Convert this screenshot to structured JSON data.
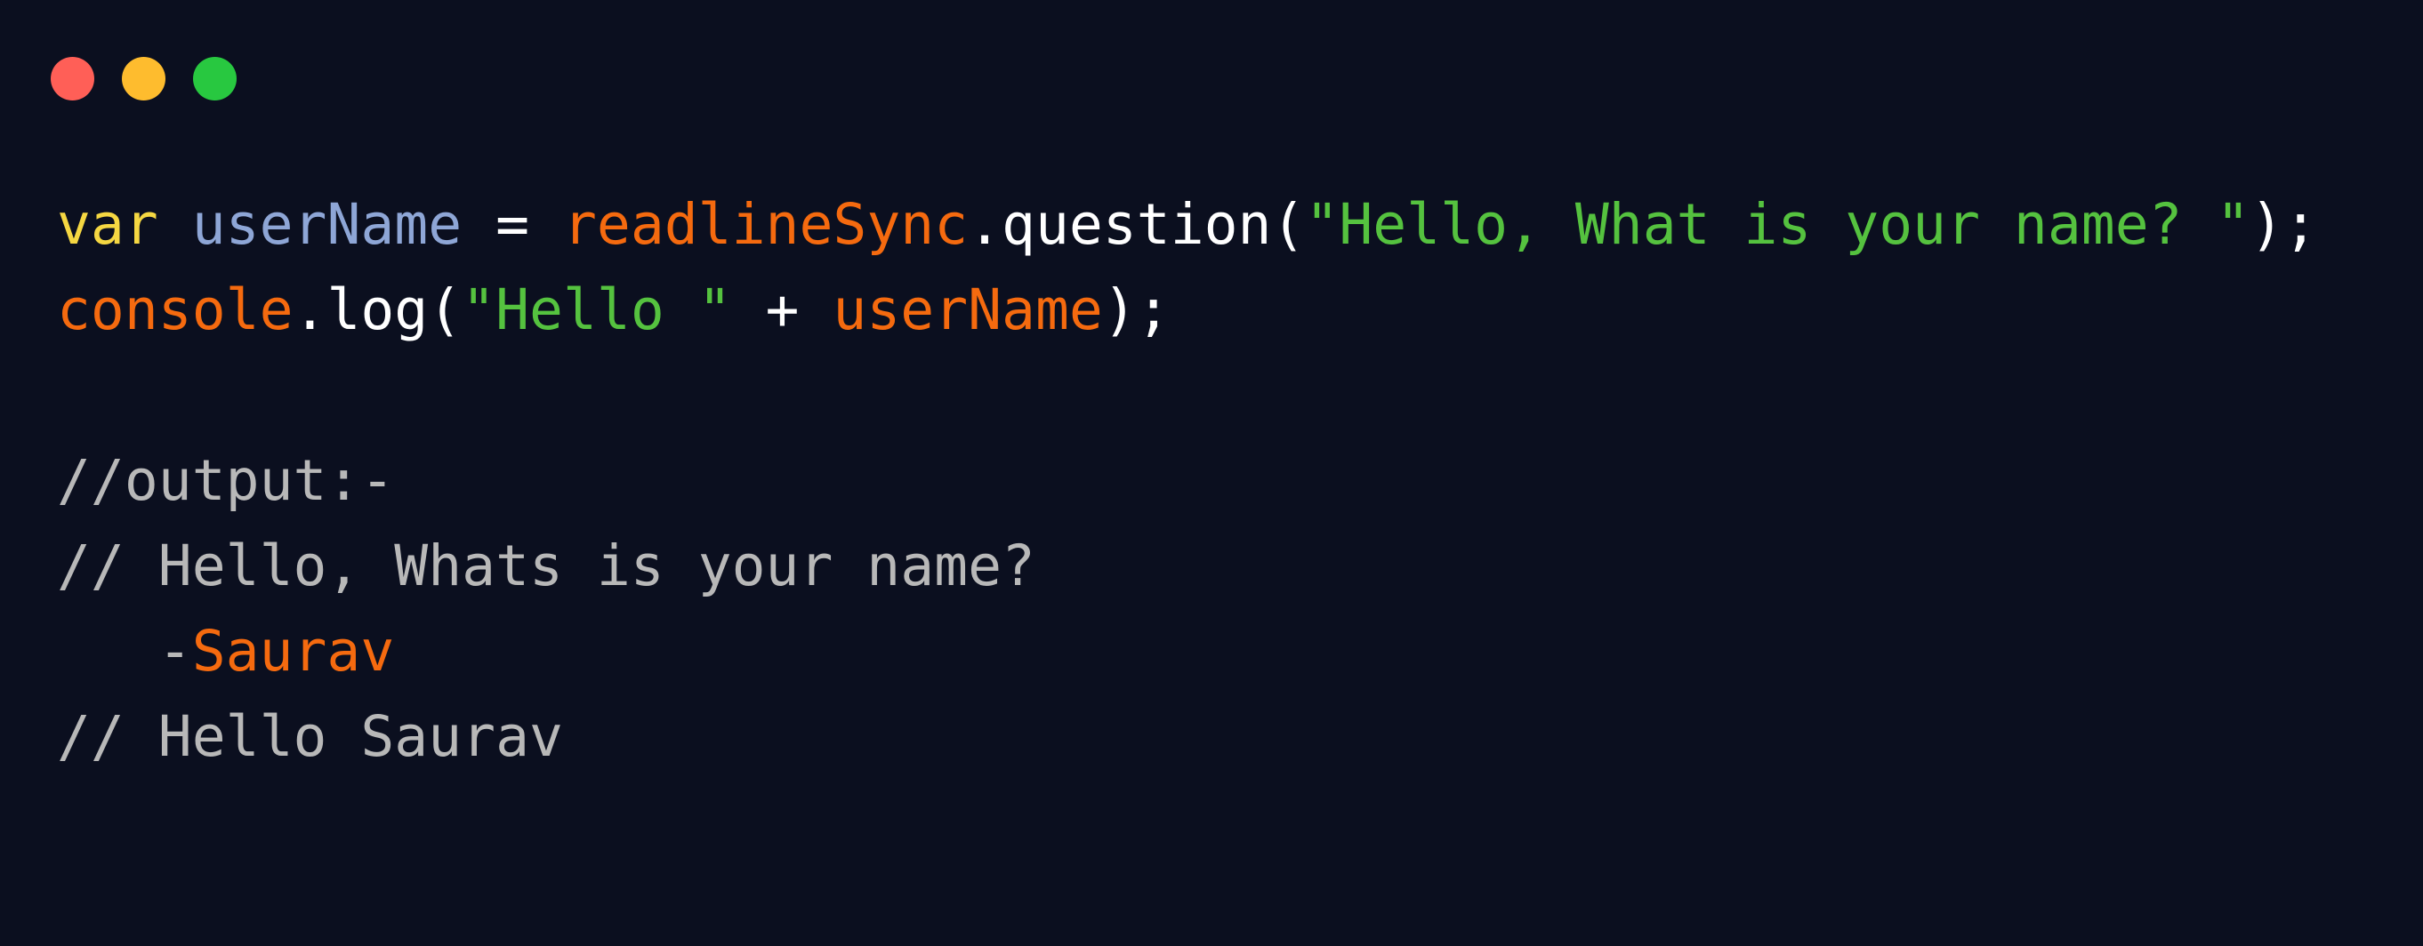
{
  "colors": {
    "background": "#0b0f1f",
    "keyword": "#f5d742",
    "variable": "#8ea6d6",
    "identifier": "#f56a0f",
    "string": "#55c23f",
    "plain": "#ffffff",
    "comment": "#b8b8b8",
    "dot_close": "#ff5f57",
    "dot_minimize": "#febc2e",
    "dot_zoom": "#28c840"
  },
  "window_controls": [
    "close",
    "minimize",
    "zoom"
  ],
  "code": {
    "line1": {
      "keyword": "var",
      "space1": " ",
      "variable": "userName",
      "op": " = ",
      "object": "readlineSync",
      "method": ".question(",
      "string": "\"Hello, What is your name? \"",
      "end": ");"
    },
    "line2": {
      "object": "console",
      "method": ".log(",
      "string": "\"Hello \"",
      "op": " + ",
      "variable": "userName",
      "end": ");"
    },
    "line3": {
      "comment": "//output:-"
    },
    "line4": {
      "comment": "// Hello, Whats is your name?"
    },
    "line5": {
      "indent": "   -",
      "value": "Saurav"
    },
    "line6": {
      "comment": "// Hello Saurav"
    }
  }
}
